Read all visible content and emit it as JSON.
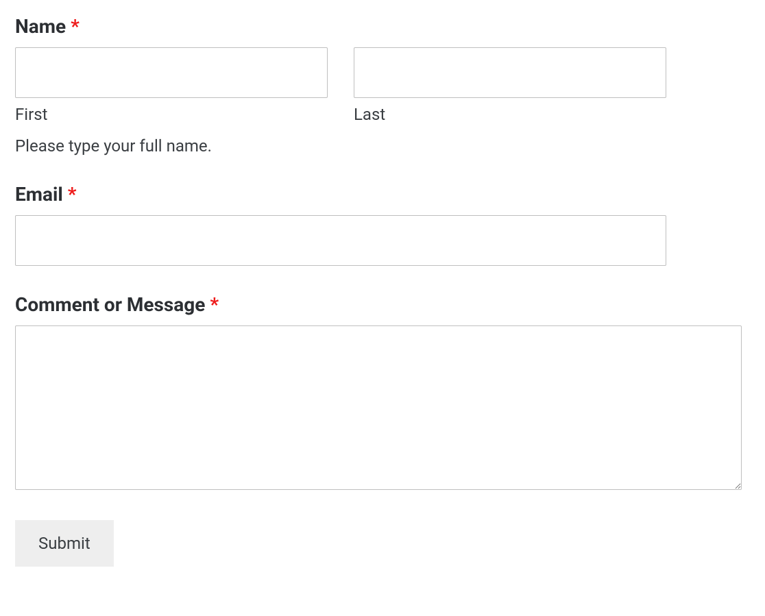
{
  "form": {
    "name": {
      "label": "Name",
      "required": "*",
      "first_sublabel": "First",
      "last_sublabel": "Last",
      "description": "Please type your full name."
    },
    "email": {
      "label": "Email",
      "required": "*"
    },
    "comment": {
      "label": "Comment or Message",
      "required": "*"
    },
    "submit": {
      "label": "Submit"
    }
  }
}
